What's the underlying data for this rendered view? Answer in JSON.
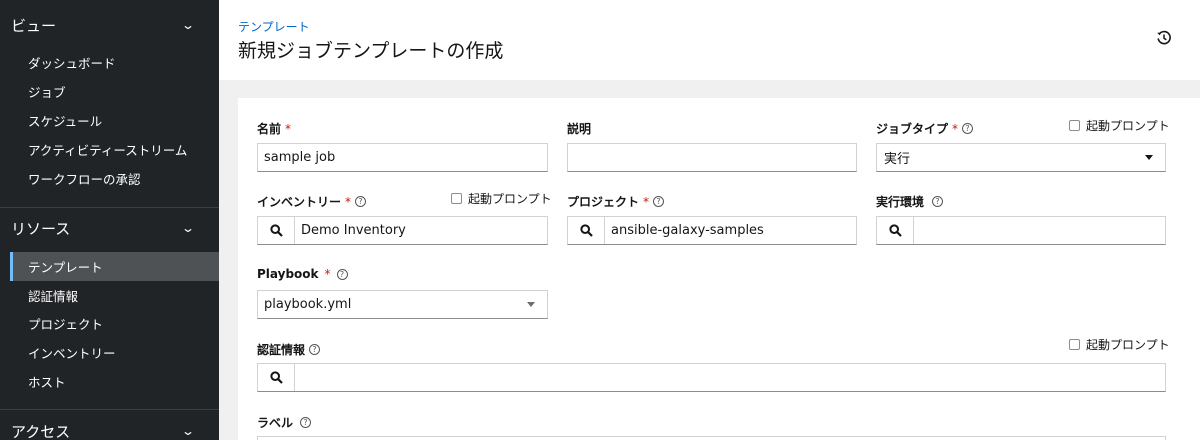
{
  "sidebar": {
    "sections": [
      {
        "label": "ビュー",
        "items": [
          "ダッシュボード",
          "ジョブ",
          "スケジュール",
          "アクティビティーストリーム",
          "ワークフローの承認"
        ]
      },
      {
        "label": "リソース",
        "items": [
          "テンプレート",
          "認証情報",
          "プロジェクト",
          "インベントリー",
          "ホスト"
        ]
      },
      {
        "label": "アクセス",
        "items": []
      }
    ],
    "active_item": "テンプレート"
  },
  "header": {
    "breadcrumb": "テンプレート",
    "title": "新規ジョブテンプレートの作成",
    "history_icon": "history-icon"
  },
  "form": {
    "name": {
      "label": "名前",
      "required": "*",
      "value": "sample job"
    },
    "description": {
      "label": "説明",
      "value": ""
    },
    "job_type": {
      "label": "ジョブタイプ",
      "required": "*",
      "value": "実行",
      "prompt": "起動プロンプト"
    },
    "inventory": {
      "label": "インベントリー",
      "required": "*",
      "value": "Demo Inventory",
      "prompt": "起動プロンプト"
    },
    "project": {
      "label": "プロジェクト",
      "required": "*",
      "value": "ansible-galaxy-samples"
    },
    "execution_env": {
      "label": "実行環境",
      "value": ""
    },
    "playbook": {
      "label": "Playbook",
      "required": "*",
      "value": "playbook.yml"
    },
    "credentials": {
      "label": "認証情報",
      "value": "",
      "prompt": "起動プロンプト"
    },
    "labels": {
      "label": "ラベル"
    },
    "help_glyph": "?"
  }
}
